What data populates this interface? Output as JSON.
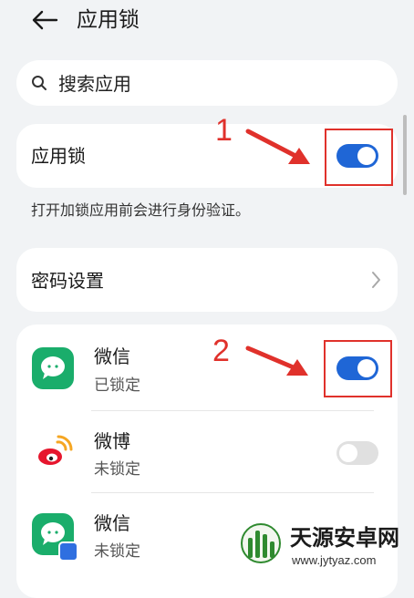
{
  "header": {
    "title": "应用锁"
  },
  "search": {
    "placeholder": "搜索应用"
  },
  "app_lock": {
    "label": "应用锁",
    "enabled": true
  },
  "description": "打开加锁应用前会进行身份验证。",
  "password": {
    "label": "密码设置"
  },
  "apps": [
    {
      "name": "微信",
      "status": "已锁定",
      "locked": true,
      "icon": "wechat-icon"
    },
    {
      "name": "微博",
      "status": "未锁定",
      "locked": false,
      "icon": "weibo-icon"
    },
    {
      "name": "微信",
      "status": "未锁定",
      "locked": false,
      "icon": "wechat-clone-icon"
    }
  ],
  "annotations": {
    "first": "1",
    "second": "2"
  },
  "watermark": {
    "title": "天源安卓网",
    "url": "www.jytyaz.com"
  },
  "colors": {
    "accent": "#1f66d6",
    "annotation": "#e0312b",
    "wechat": "#1aad6b"
  }
}
